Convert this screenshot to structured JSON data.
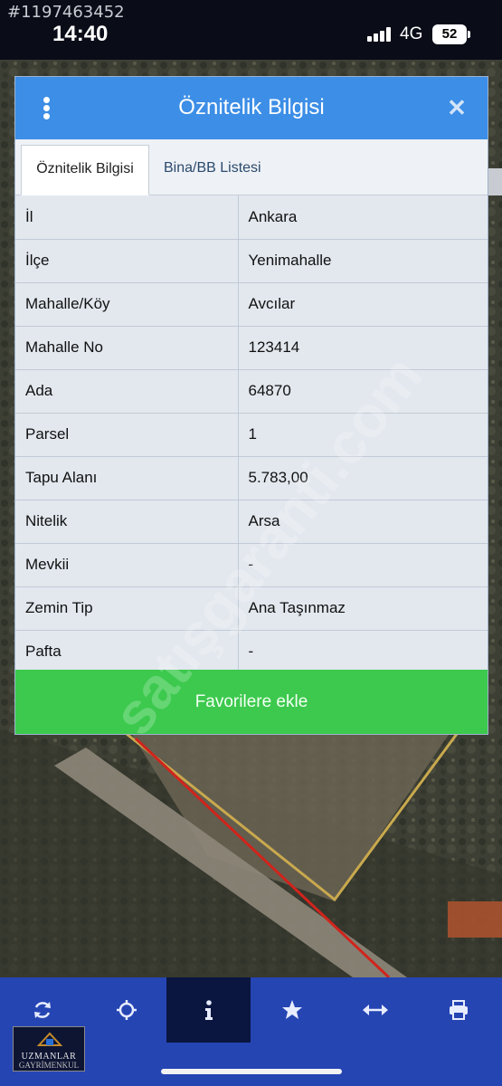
{
  "status_bar": {
    "listing_id": "#1197463452",
    "time": "14:40",
    "network": "4G",
    "battery": "52"
  },
  "dialog": {
    "title": "Öznitelik Bilgisi",
    "tabs": [
      {
        "label": "Öznitelik Bilgisi",
        "active": true
      },
      {
        "label": "Bina/BB Listesi",
        "active": false
      }
    ],
    "rows": [
      {
        "key": "İl",
        "value": "Ankara"
      },
      {
        "key": "İlçe",
        "value": "Yenimahalle"
      },
      {
        "key": "Mahalle/Köy",
        "value": "Avcılar"
      },
      {
        "key": "Mahalle No",
        "value": "123414"
      },
      {
        "key": "Ada",
        "value": "64870"
      },
      {
        "key": "Parsel",
        "value": "1"
      },
      {
        "key": "Tapu Alanı",
        "value": "5.783,00"
      },
      {
        "key": "Nitelik",
        "value": "Arsa"
      },
      {
        "key": "Mevkii",
        "value": "-"
      },
      {
        "key": "Zemin Tip",
        "value": "Ana Taşınmaz"
      },
      {
        "key": "Pafta",
        "value": "-"
      }
    ],
    "favorite_button": "Favorilere ekle"
  },
  "watermark": "satışgaranti.com",
  "toolbar": {
    "items": [
      {
        "icon": "refresh-icon"
      },
      {
        "icon": "locate-icon"
      },
      {
        "icon": "info-icon",
        "active": true
      },
      {
        "icon": "star-icon"
      },
      {
        "icon": "measure-icon"
      },
      {
        "icon": "print-icon"
      }
    ]
  },
  "logo": {
    "line1": "UZMANLAR",
    "line2": "GAYRİMENKUL"
  },
  "colors": {
    "header": "#3c8ee6",
    "favorite": "#3cc94e",
    "toolbar": "#2545b3",
    "parcel_border": "#c9a94e",
    "road_line": "#d0241c"
  }
}
